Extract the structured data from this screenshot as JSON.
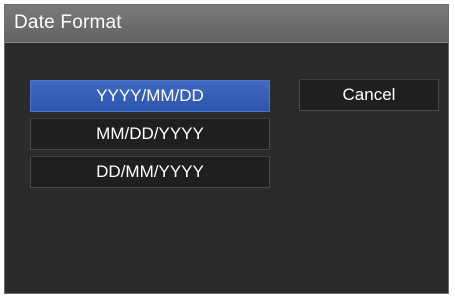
{
  "dialog": {
    "title": "Date Format"
  },
  "options": [
    {
      "label": "YYYY/MM/DD",
      "selected": true
    },
    {
      "label": "MM/DD/YYYY",
      "selected": false
    },
    {
      "label": "DD/MM/YYYY",
      "selected": false
    }
  ],
  "cancel_label": "Cancel",
  "colors": {
    "dialog_background": "#2b2b2b",
    "titlebar": "#6e6e6e",
    "selected_button": "#3560b8",
    "button": "#1f1f1f",
    "text": "#ffffff"
  }
}
